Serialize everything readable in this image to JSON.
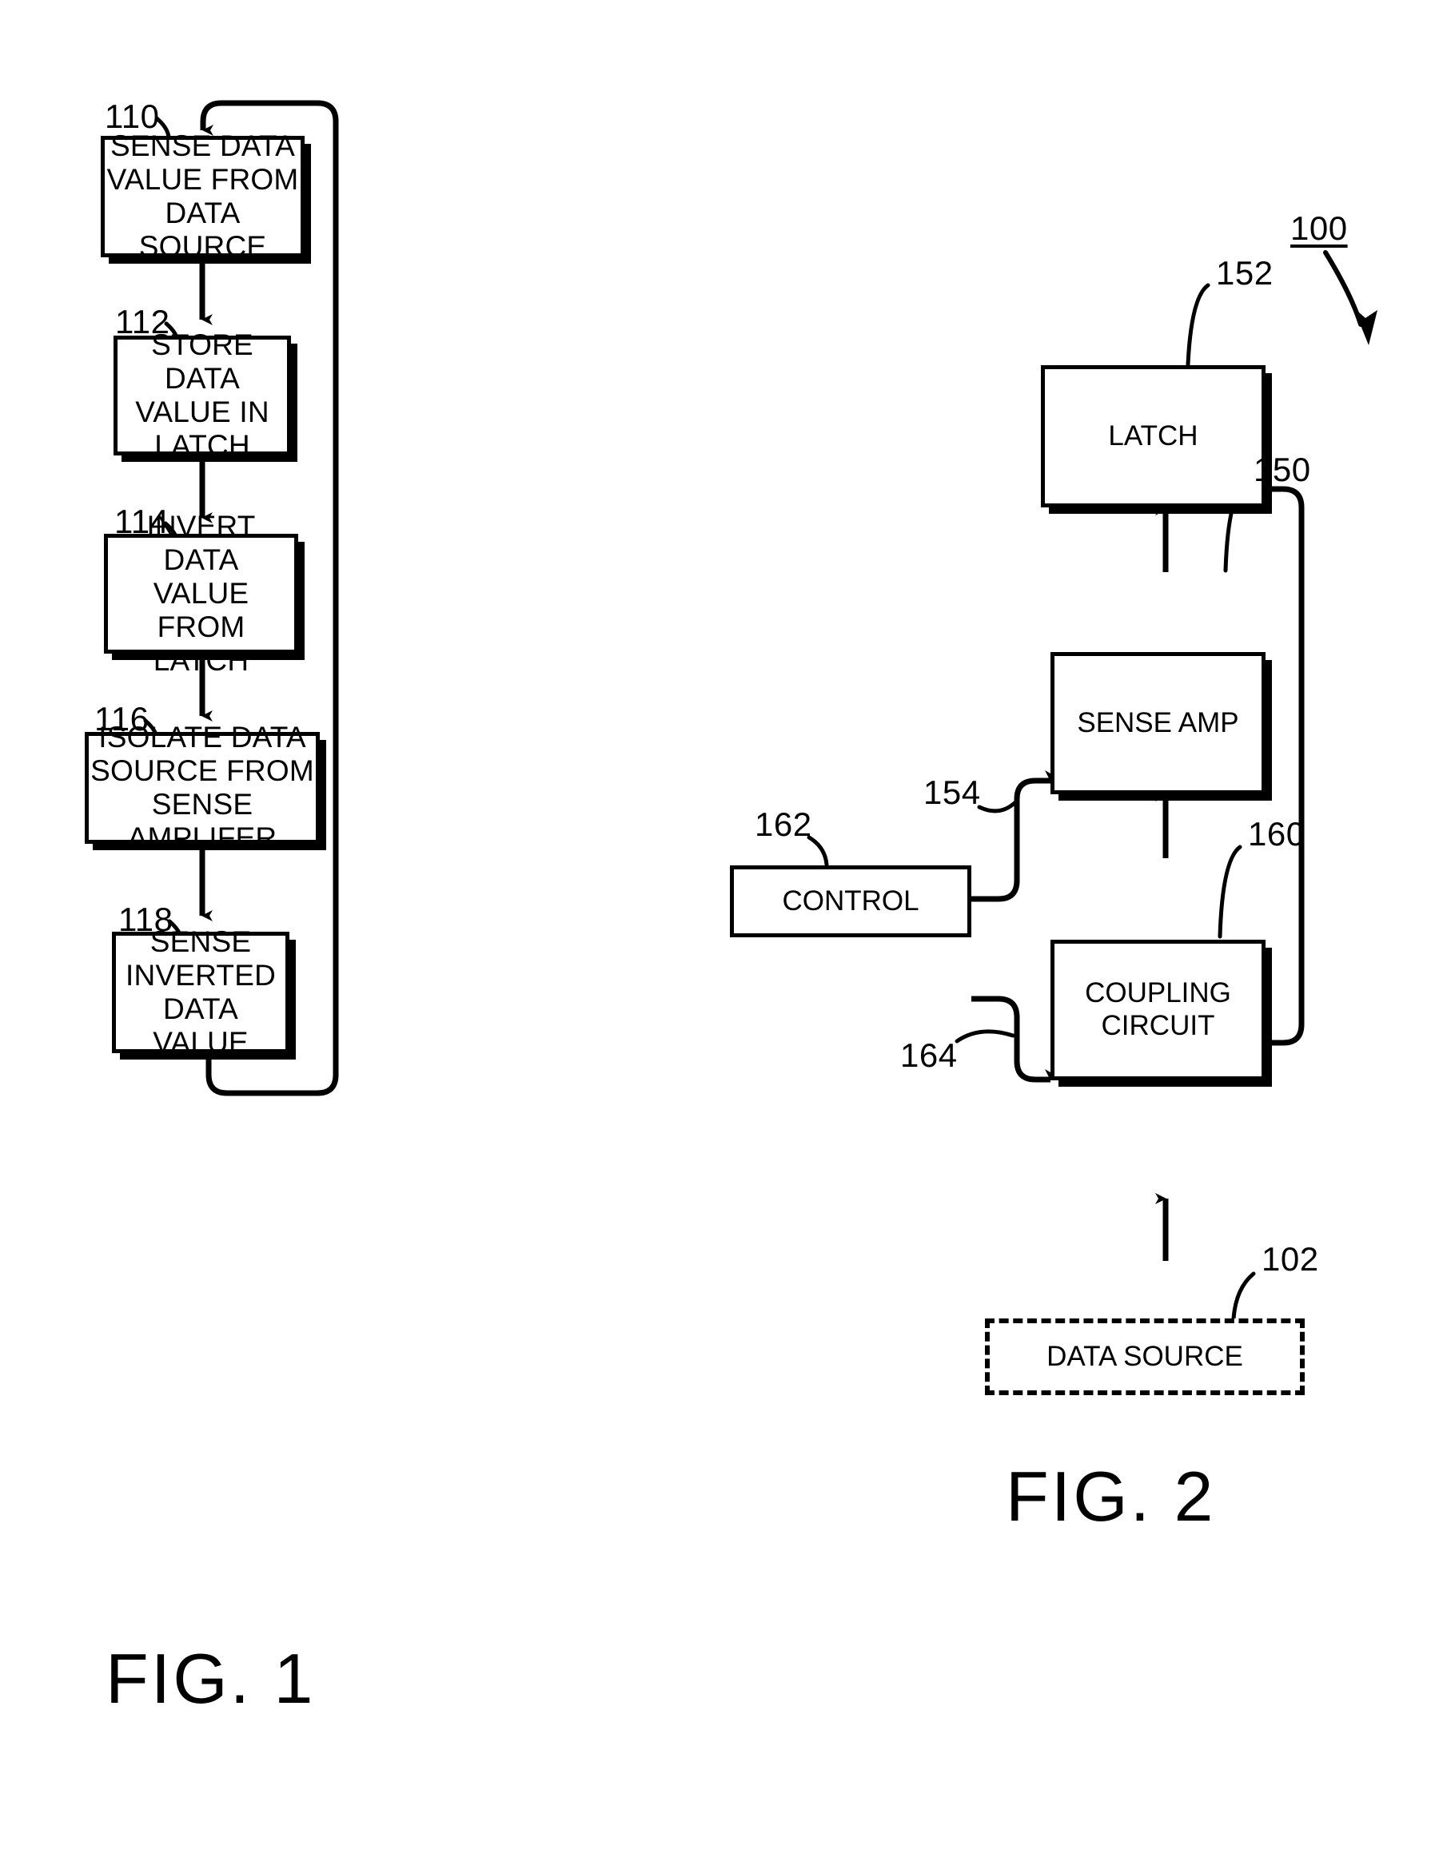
{
  "figure1": {
    "caption": "FIG. 1",
    "steps": [
      {
        "ref": "110",
        "label": "SENSE  DATA\nVALUE FROM\nDATA SOURCE"
      },
      {
        "ref": "112",
        "label": "STORE DATA\nVALUE IN\nLATCH"
      },
      {
        "ref": "114",
        "label": "INVERT DATA\nVALUE FROM\nLATCH"
      },
      {
        "ref": "116",
        "label": "ISOLATE DATA\nSOURCE FROM\nSENSE AMPLIFER"
      },
      {
        "ref": "118",
        "label": "SENSE\nINVERTED\nDATA VALUE"
      }
    ]
  },
  "figure2": {
    "caption": "FIG. 2",
    "system_ref": "100",
    "blocks": [
      {
        "ref": "152",
        "label": "LATCH"
      },
      {
        "ref": "150",
        "label": "SENSE AMP"
      },
      {
        "ref": "160",
        "label": "COUPLING\nCIRCUIT"
      },
      {
        "ref": "162",
        "label": "CONTROL"
      },
      {
        "ref": "102",
        "label": "DATA SOURCE"
      }
    ],
    "signal_refs": [
      {
        "ref": "154"
      },
      {
        "ref": "164"
      }
    ]
  },
  "colors": {
    "ink": "#000000",
    "paper": "#ffffff"
  }
}
